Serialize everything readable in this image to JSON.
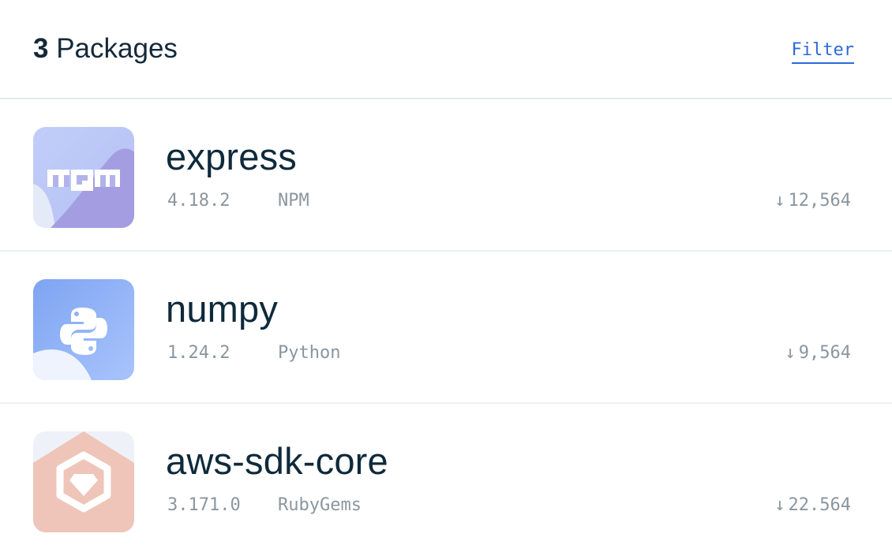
{
  "header": {
    "count": "3",
    "count_label": "Packages",
    "filter_label": "Filter"
  },
  "packages": [
    {
      "name": "express",
      "version": "4.18.2",
      "registry": "NPM",
      "downloads": "12,564",
      "icon": "npm-icon",
      "icon_text": "npm",
      "colors": [
        "#b9c7f6",
        "#a49be3"
      ]
    },
    {
      "name": "numpy",
      "version": "1.24.2",
      "registry": "Python",
      "downloads": "9,564",
      "icon": "python-icon",
      "colors": [
        "#7fa6f3",
        "#a5c0fb"
      ]
    },
    {
      "name": "aws-sdk-core",
      "version": "3.171.0",
      "registry": "RubyGems",
      "downloads": "22.564",
      "icon": "rubygems-icon",
      "colors": [
        "#f2c4b8",
        "#e9c8bd"
      ]
    }
  ],
  "download_arrow": "↓",
  "colors": {
    "text": "#0e2a3b",
    "meta": "#8a969f",
    "link": "#2d6ad6",
    "divider": "#e6e8ea"
  }
}
